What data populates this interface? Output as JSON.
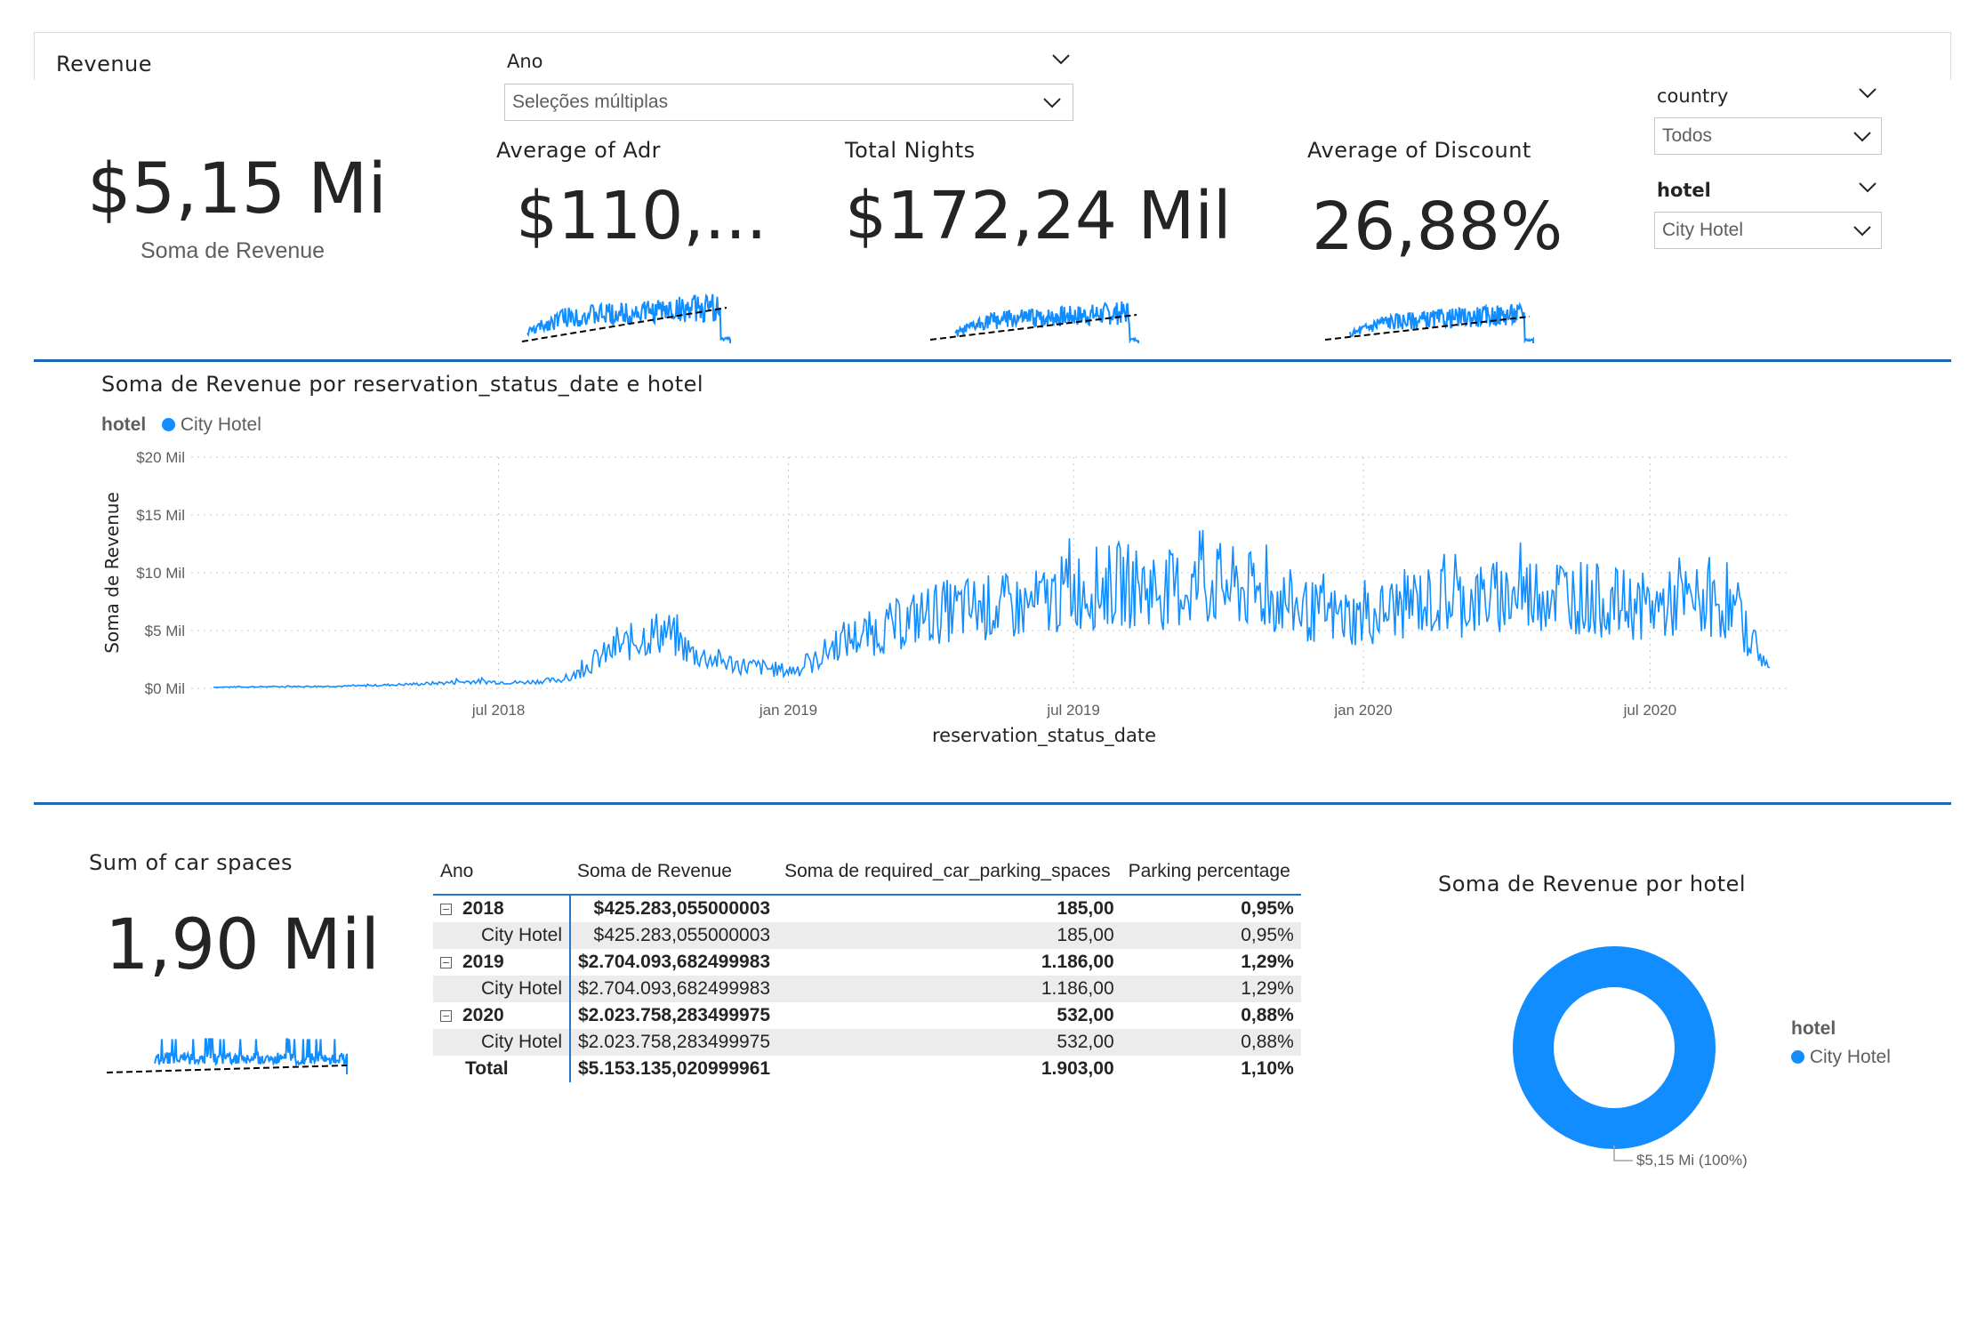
{
  "revenue_card": {
    "title": "Revenue",
    "value": "$5,15 Mi",
    "subtitle": "Soma de Revenue"
  },
  "slicer_ano": {
    "title": "Ano",
    "selected": "Seleções múltiplas",
    "icon": "chevron-down-icon"
  },
  "slicer_country": {
    "title": "country",
    "selected": "Todos",
    "icon": "chevron-down-icon"
  },
  "slicer_hotel": {
    "title": "hotel",
    "selected": "City Hotel",
    "icon": "chevron-down-icon"
  },
  "kpi_adr": {
    "title": "Average of Adr",
    "value": "$110,..."
  },
  "kpi_nights": {
    "title": "Total Nights",
    "value": "$172,24 Mil"
  },
  "kpi_discount": {
    "title": "Average of Discount",
    "value": "26,88%"
  },
  "kpi_car": {
    "title": "Sum of car spaces",
    "value": "1,90 Mil"
  },
  "line_chart": {
    "title": "Soma de Revenue por reservation_status_date e hotel",
    "legend_title": "hotel",
    "legend_item": "City Hotel"
  },
  "chart_data": [
    {
      "type": "line",
      "title": "Soma de Revenue por reservation_status_date e hotel",
      "xlabel": "reservation_status_date",
      "ylabel": "Soma de Revenue",
      "legend_placement": "top-left",
      "grid": true,
      "y_ticks": [
        "$0 Mil",
        "$5 Mil",
        "$10 Mil",
        "$15 Mil",
        "$20 Mil"
      ],
      "x_ticks": [
        "jul 2018",
        "jan 2019",
        "jul 2019",
        "jan 2020",
        "jul 2020"
      ],
      "ylim": [
        0,
        20000
      ],
      "series": [
        {
          "name": "City Hotel",
          "color": "#118dff",
          "x": [
            "2018-01-01",
            "2018-02-15",
            "2018-04-01",
            "2018-05-15",
            "2018-06-15",
            "2018-07-15",
            "2018-08-15",
            "2018-09-01",
            "2018-09-15",
            "2018-10-01",
            "2018-10-15",
            "2018-11-01",
            "2018-11-15",
            "2018-12-01",
            "2018-12-15",
            "2019-01-01",
            "2019-01-15",
            "2019-02-01",
            "2019-03-01",
            "2019-04-01",
            "2019-05-01",
            "2019-06-01",
            "2019-07-01",
            "2019-08-01",
            "2019-09-01",
            "2019-10-01",
            "2019-11-01",
            "2019-12-01",
            "2020-01-01",
            "2020-02-01",
            "2020-03-01",
            "2020-04-01",
            "2020-05-01",
            "2020-06-01",
            "2020-07-01",
            "2020-08-01",
            "2020-08-20",
            "2020-09-05",
            "2020-09-15"
          ],
          "values": [
            100,
            150,
            200,
            400,
            600,
            500,
            800,
            2500,
            3500,
            4500,
            5000,
            3000,
            2500,
            2000,
            1800,
            1500,
            2000,
            4000,
            5000,
            6500,
            7000,
            7000,
            8500,
            9000,
            8500,
            9000,
            8000,
            6500,
            6000,
            7500,
            7500,
            8000,
            8500,
            7500,
            7000,
            7500,
            7000,
            4000,
            1500
          ]
        }
      ]
    },
    {
      "type": "table",
      "columns": [
        "Ano",
        "Soma de Revenue",
        "Soma de required_car_parking_spaces",
        "Parking percentage"
      ],
      "rows": [
        [
          "2018",
          "$425.283,055000003",
          "185,00",
          "0,95%"
        ],
        [
          "City Hotel",
          "$425.283,055000003",
          "185,00",
          "0,95%"
        ],
        [
          "2019",
          "$2.704.093,682499983",
          "1.186,00",
          "1,29%"
        ],
        [
          "City Hotel",
          "$2.704.093,682499983",
          "1.186,00",
          "1,29%"
        ],
        [
          "2020",
          "$2.023.758,283499975",
          "532,00",
          "0,88%"
        ],
        [
          "City Hotel",
          "$2.023.758,283499975",
          "532,00",
          "0,88%"
        ],
        [
          "Total",
          "$5.153.135,020999961",
          "1.903,00",
          "1,10%"
        ]
      ]
    },
    {
      "type": "pie",
      "title": "Soma de Revenue por hotel",
      "legend_title": "hotel",
      "legend_placement": "right",
      "categories": [
        "City Hotel"
      ],
      "values": [
        5153135.02
      ],
      "data_labels": [
        "$5,15 Mi (100%)"
      ],
      "colors": [
        "#118dff"
      ]
    }
  ],
  "matrix": {
    "headers": [
      "Ano",
      "Soma de Revenue",
      "Soma de required_car_parking_spaces",
      "Parking percentage"
    ],
    "rows": [
      {
        "label": "2018",
        "revenue": "$425.283,055000003",
        "spaces": "185,00",
        "pct": "0,95%"
      },
      {
        "label": "City Hotel",
        "revenue": "$425.283,055000003",
        "spaces": "185,00",
        "pct": "0,95%"
      },
      {
        "label": "2019",
        "revenue": "$2.704.093,682499983",
        "spaces": "1.186,00",
        "pct": "1,29%"
      },
      {
        "label": "City Hotel",
        "revenue": "$2.704.093,682499983",
        "spaces": "1.186,00",
        "pct": "1,29%"
      },
      {
        "label": "2020",
        "revenue": "$2.023.758,283499975",
        "spaces": "532,00",
        "pct": "0,88%"
      },
      {
        "label": "City Hotel",
        "revenue": "$2.023.758,283499975",
        "spaces": "532,00",
        "pct": "0,88%"
      },
      {
        "label": "Total",
        "revenue": "$5.153.135,020999961",
        "spaces": "1.903,00",
        "pct": "1,10%"
      }
    ]
  },
  "donut": {
    "title": "Soma de Revenue por hotel",
    "legend_title": "hotel",
    "legend_item": "City Hotel",
    "data_label": "$5,15 Mi (100%)"
  },
  "colors": {
    "accent": "#118dff",
    "divider": "#1f67b1",
    "trend": "#000000"
  }
}
